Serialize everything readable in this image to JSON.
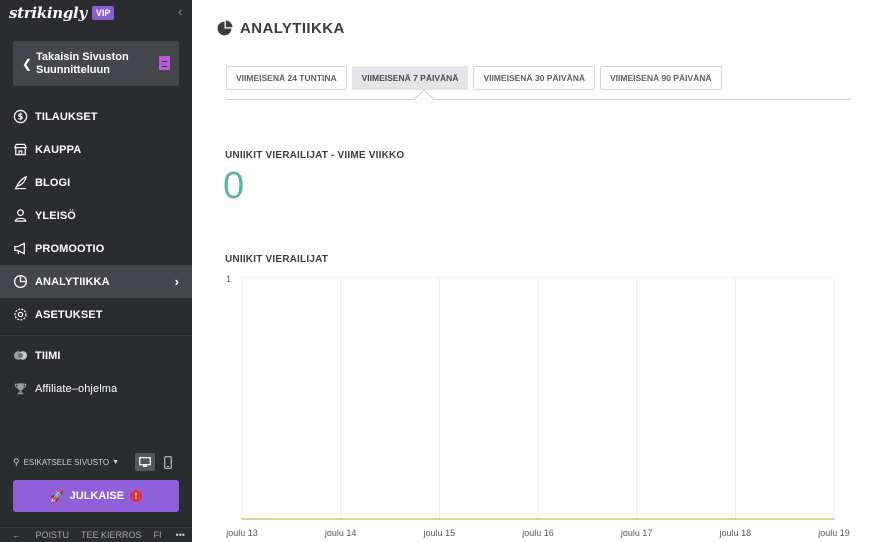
{
  "sidebar": {
    "brand": "strikingly",
    "vip_badge": "VIP",
    "back_button": "Takaisin Sivuston Suunnitteluun",
    "items": [
      {
        "label": "TILAUKSET",
        "icon": "dollar-circle-icon"
      },
      {
        "label": "KAUPPA",
        "icon": "store-icon"
      },
      {
        "label": "BLOGI",
        "icon": "feather-icon"
      },
      {
        "label": "YLEISÖ",
        "icon": "audience-icon"
      },
      {
        "label": "PROMOOTIO",
        "icon": "megaphone-icon"
      },
      {
        "label": "ANALYTIIKKA",
        "icon": "pie-chart-icon",
        "active": true
      },
      {
        "label": "ASETUKSET",
        "icon": "gear-icon"
      },
      {
        "label": "TIIMI",
        "icon": "team-icon"
      },
      {
        "label": "Affiliate–ohjelma",
        "icon": "trophy-icon"
      }
    ],
    "preview_label": "ESIKATSELE SIVUSTO",
    "publish_label": "JULKAISE",
    "publish_alert": "!",
    "footer": {
      "exit": "POISTU",
      "tour": "TEE KIERROS",
      "lang": "FI",
      "more": "•••"
    }
  },
  "main": {
    "title": "ANALYTIIKKA",
    "tabs": [
      {
        "label": "VIIMEISENÄ 24 TUNTINA",
        "active": false
      },
      {
        "label": "VIIMEISENÄ 7 PÄIVÄNÄ",
        "active": true
      },
      {
        "label": "VIIMEISENÄ 30 PÄIVÄNÄ",
        "active": false
      },
      {
        "label": "VIIMEISENÄ 90 PÄIVÄNÄ",
        "active": false
      }
    ],
    "unique_visitors_label": "UNIIKIT VIERAILIJAT - VIIME VIIKKO",
    "unique_visitors_value": "0",
    "chart_label": "UNIIKIT VIERAILIJAT"
  },
  "colors": {
    "sidebar_bg": "#2b2c30",
    "accent_purple": "#8f5fd8",
    "teal_value": "#5fb3a3",
    "line_green": "#b5d06e"
  },
  "chart_data": {
    "type": "line",
    "title": "UNIIKIT VIERAILIJAT",
    "categories": [
      "joulu 13",
      "joulu 14",
      "joulu 15",
      "joulu 16",
      "joulu 17",
      "joulu 18",
      "joulu 19"
    ],
    "series": [
      {
        "values": [
          0,
          0,
          0,
          0,
          0,
          0,
          0
        ]
      }
    ],
    "ylim": [
      0,
      1
    ],
    "yticks": [
      "1"
    ],
    "grid": true
  }
}
